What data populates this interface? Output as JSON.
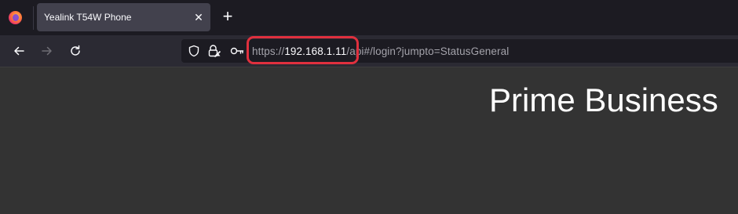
{
  "browser": {
    "tab": {
      "title": "Yealink T54W Phone",
      "close_label": "✕"
    },
    "new_tab_label": "+",
    "url": {
      "scheme": "https://",
      "host": "192.168.1.11",
      "path": "/api#/login?jumpto=StatusGeneral"
    },
    "icons": {
      "logo": "firefox-icon",
      "back": "back-arrow-icon",
      "forward": "forward-arrow-icon",
      "reload": "reload-icon",
      "shield": "tracking-protection-shield-icon",
      "lock": "insecure-lock-icon",
      "key": "key-icon"
    },
    "highlight_color": "#e0303e"
  },
  "page": {
    "heading": "Prime Business"
  }
}
